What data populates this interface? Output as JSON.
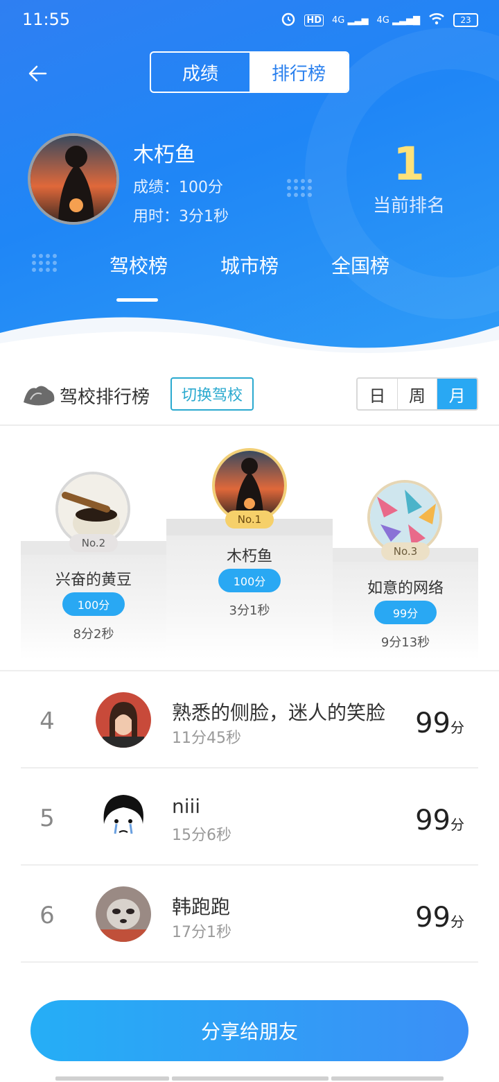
{
  "status": {
    "time": "11:55",
    "battery": "23",
    "hd": "HD",
    "net1": "4G",
    "net2": "4G"
  },
  "header": {
    "tabs": [
      "成绩",
      "排行榜"
    ],
    "me": {
      "name": "木朽鱼",
      "score_label": "成绩：100分",
      "time_label": "用时：3分1秒"
    },
    "rank_value": "1",
    "rank_label": "当前排名",
    "board_tabs": [
      "驾校榜",
      "城市榜",
      "全国榜"
    ]
  },
  "school": {
    "title": "驾校排行榜",
    "switch_label": "切换驾校",
    "periods": [
      "日",
      "周",
      "月"
    ],
    "active_period": "月"
  },
  "podium": [
    {
      "rank_label": "No.2",
      "name": "兴奋的黄豆",
      "score": "100分",
      "time": "8分2秒"
    },
    {
      "rank_label": "No.1",
      "name": "木朽鱼",
      "score": "100分",
      "time": "3分1秒"
    },
    {
      "rank_label": "No.3",
      "name": "如意的网络",
      "score": "99分",
      "time": "9分13秒"
    }
  ],
  "list": [
    {
      "rank": "4",
      "name": "熟悉的侧脸，迷人的笑脸",
      "time": "11分45秒",
      "score": "99",
      "unit": "分"
    },
    {
      "rank": "5",
      "name": "niii",
      "time": "15分6秒",
      "score": "99",
      "unit": "分"
    },
    {
      "rank": "6",
      "name": "韩跑跑",
      "time": "17分1秒",
      "score": "99",
      "unit": "分"
    }
  ],
  "share_label": "分享给朋友",
  "colors": {
    "header_blue": "#1f86f6",
    "accent": "#29a8f3",
    "gold": "#fde27a"
  }
}
